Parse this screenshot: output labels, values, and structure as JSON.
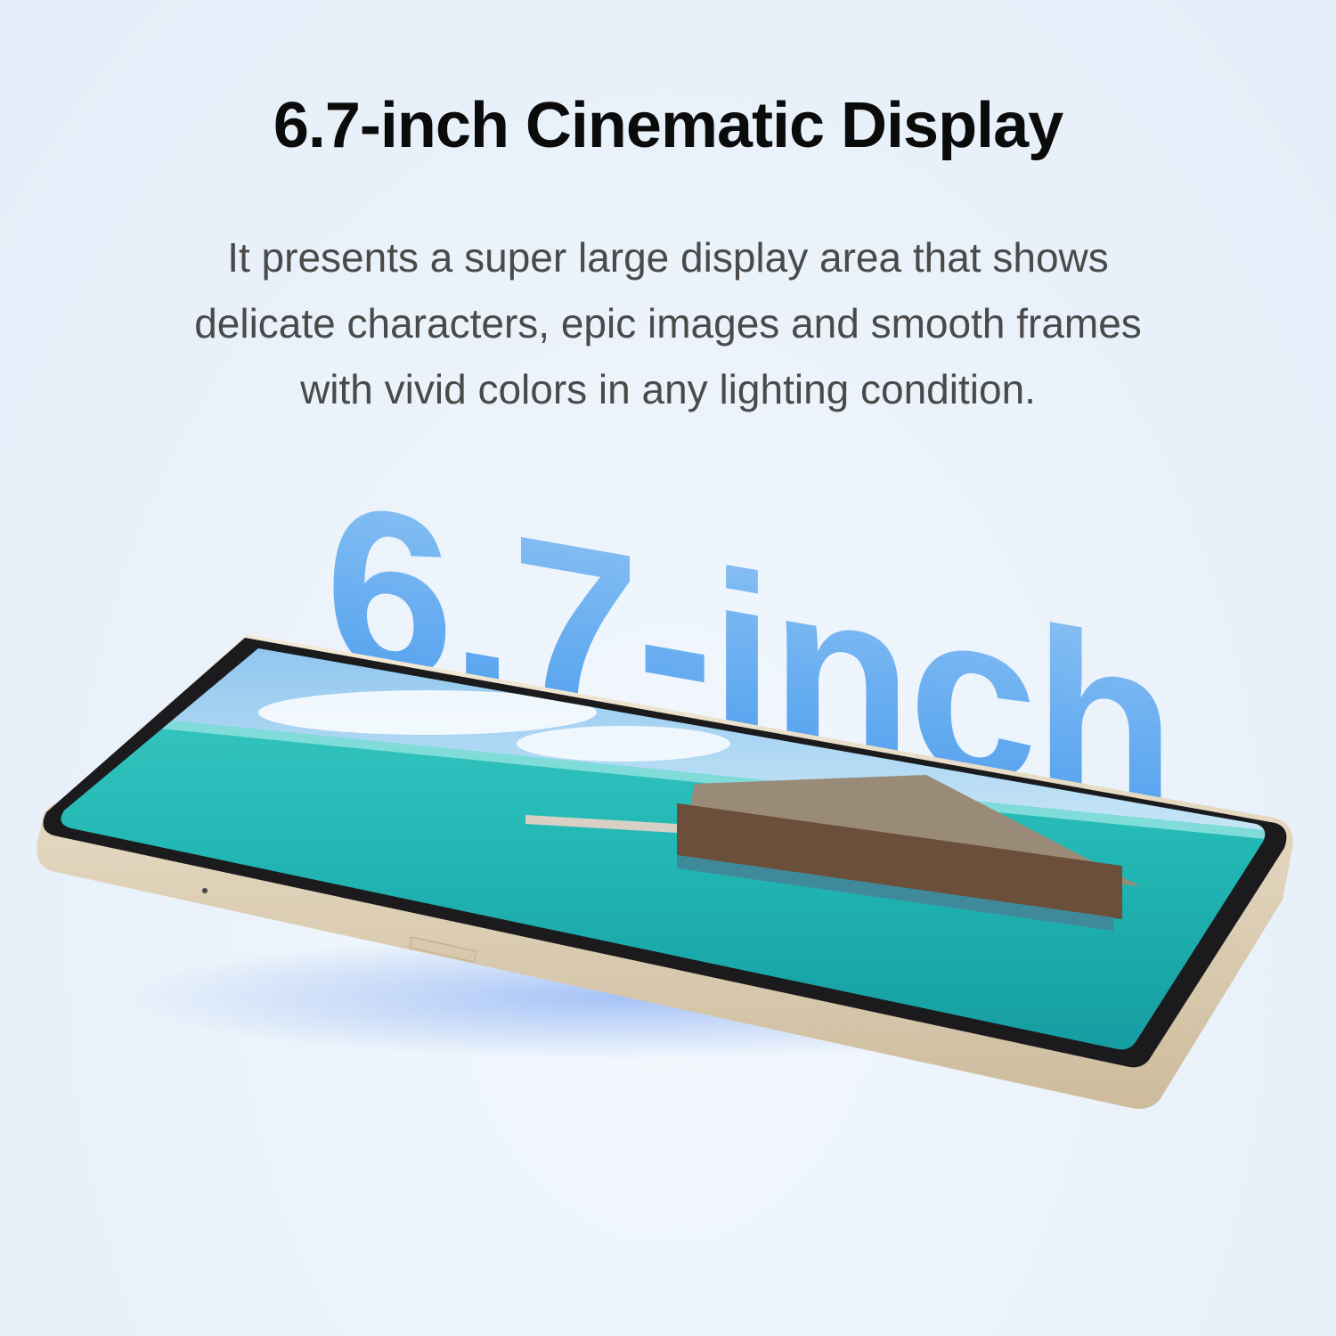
{
  "title": "6.7-inch Cinematic Display",
  "description": [
    "It presents a super large display area that shows",
    "delicate characters, epic images and smooth frames",
    "with vivid colors in any lighting condition."
  ],
  "hero_text": "6.7-inch",
  "colors": {
    "accent_blue": "#5fa8f0",
    "phone_frame": "#e6d9c2",
    "sea": "#2fc4c0"
  }
}
